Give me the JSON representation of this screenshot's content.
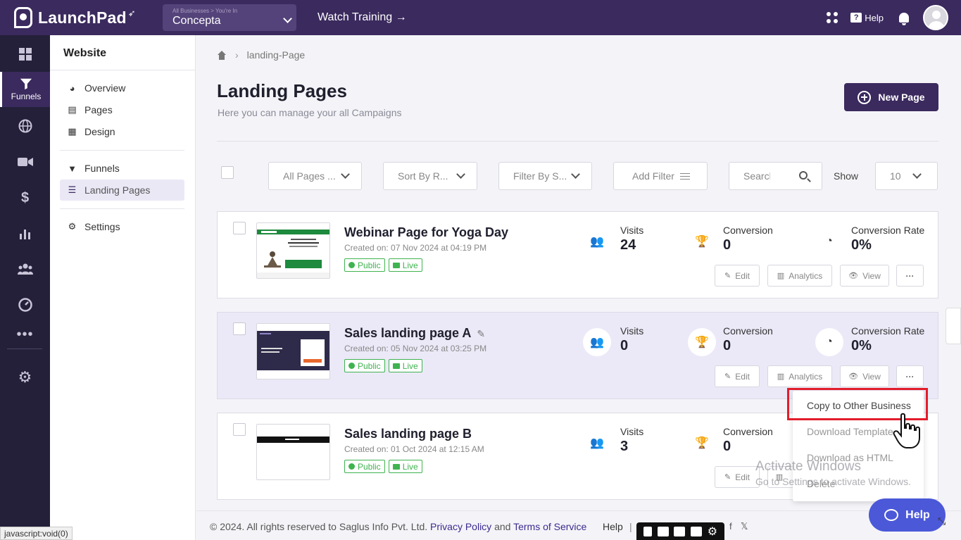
{
  "topbar": {
    "logo": "LaunchPad",
    "business_caption": "All Businesses > You're In",
    "business_name": "Concepta",
    "watch_training": "Watch Training →",
    "help": "Help"
  },
  "rail": {
    "active_label": "Funnels"
  },
  "subsidebar": {
    "title": "Website",
    "items": [
      "Overview",
      "Pages",
      "Design",
      "Funnels",
      "Landing Pages",
      "Settings"
    ]
  },
  "breadcrumb": {
    "current": "landing-Page"
  },
  "header": {
    "title": "Landing Pages",
    "subtitle": "Here you can manage your all Campaigns",
    "new_page": "New Page"
  },
  "toolbar": {
    "all_pages": "All Pages ...",
    "sort_by": "Sort By R...",
    "filter_by": "Filter By S...",
    "add_filter": "Add Filter",
    "search_placeholder": "Search",
    "show_label": "Show",
    "show_value": "10"
  },
  "labels": {
    "visits": "Visits",
    "conversion": "Conversion",
    "conversion_rate": "Conversion Rate",
    "public": "Public",
    "live": "Live",
    "edit": "Edit",
    "analytics": "Analytics",
    "view": "View",
    "more": "···"
  },
  "pages": [
    {
      "title": "Webinar Page for Yoga Day",
      "created": "Created on: 07 Nov 2024 at 04:19 PM",
      "visits": "24",
      "conversion": "0",
      "conversion_rate": "0%"
    },
    {
      "title": "Sales landing page A",
      "created": "Created on: 05 Nov 2024 at 03:25 PM",
      "visits": "0",
      "conversion": "0",
      "conversion_rate": "0%"
    },
    {
      "title": "Sales landing page B",
      "created": "Created on: 01 Oct 2024 at 12:15 AM",
      "visits": "3",
      "conversion": "0"
    }
  ],
  "menu": {
    "items": [
      "Copy to Other Business",
      "Download Template",
      "Download as HTML",
      "Delete"
    ]
  },
  "watermark": {
    "title": "Activate Windows",
    "subtitle": "Go to Settings to activate Windows."
  },
  "footer": {
    "copyright": "© 2024. All rights reserved to Saglus Info Pvt. Ltd.",
    "privacy": "Privacy Policy",
    "and": "and",
    "terms": "Terms of Service",
    "help": "Help",
    "sep": "|"
  },
  "help_float": "Help",
  "status_url": "javascript:void(0)",
  "colors": {
    "brand": "#3b2a5e",
    "rail": "#24203a",
    "accent_green": "#3fb34f",
    "highlight_red": "#e21d2b",
    "help_blue": "#4b58d8"
  }
}
